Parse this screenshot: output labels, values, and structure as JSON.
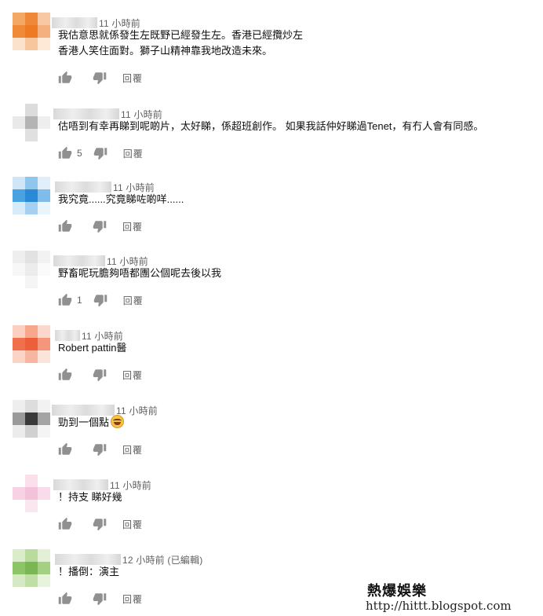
{
  "comments": [
    {
      "time": "11 小時前",
      "lines": [
        "我估意思就係發生左既野已經發生左。香港已經攬炒左",
        "香港人笑住面對。獅子山精神靠我地改造未來。"
      ],
      "likes": "",
      "reply_label": "回覆",
      "avatar_colors": [
        "#f4a866",
        "#f0883a",
        "#f8c8a4",
        "#f08a38",
        "#ee7a24",
        "#f4b07e",
        "#fbe2cc",
        "#f7c69c",
        "#fde9d6"
      ]
    },
    {
      "time": "11 小時前",
      "lines": [
        "估唔到有幸再睇到呢啲片，太好睇，係超班創作。 如果我話仲好睇過Tenet，有冇人會有同感。"
      ],
      "likes": "5",
      "reply_label": "回覆",
      "avatar_colors": [
        "#ffffff",
        "#dcdcdc",
        "#ffffff",
        "#e9e9e9",
        "#b4b4b4",
        "#eeeeee",
        "#ffffff",
        "#e0e0e0",
        "#ffffff"
      ]
    },
    {
      "time": "11 小時前",
      "lines": [
        "我究竟......究竟睇咗啲咩......"
      ],
      "likes": "",
      "reply_label": "回覆",
      "avatar_colors": [
        "#cfe6f8",
        "#8ec6ee",
        "#e1effa",
        "#4aa2e0",
        "#2a8ad6",
        "#7fbcea",
        "#d8ebf8",
        "#a6d0f2",
        "#eaf4fc"
      ]
    },
    {
      "time": "11 小時前",
      "lines": [
        "野畜呢玩膽夠唔都團公個呢去後以我"
      ],
      "likes": "1",
      "reply_label": "回覆",
      "avatar_colors": [
        "#eeeeee",
        "#e2e2e2",
        "#f2f2f2",
        "#f7f7f7",
        "#ececec",
        "#fafafa",
        "#ffffff",
        "#f5f5f5",
        "#ffffff"
      ]
    },
    {
      "time": "11 小時前",
      "lines": [
        "Robert pattin醫"
      ],
      "likes": "",
      "reply_label": "回覆",
      "avatar_colors": [
        "#fbd0c0",
        "#f6a78c",
        "#fcd8cc",
        "#f0704e",
        "#ec5f3a",
        "#f3967a",
        "#fbd4c6",
        "#f7b6a0",
        "#fde4da"
      ]
    },
    {
      "time": "11 小時前",
      "lines": [
        "勁到一個點"
      ],
      "likes": "",
      "reply_label": "回覆",
      "avatar_colors": [
        "#eeeeee",
        "#dddddd",
        "#f2f2f2",
        "#9a9a9a",
        "#3a3a3a",
        "#a4a4a4",
        "#ececec",
        "#d0d0d0",
        "#f4f4f4"
      ]
    },
    {
      "time": "11 小時前",
      "lines": [
        "！持支 睇好幾"
      ],
      "likes": "",
      "reply_label": "回覆",
      "avatar_colors": [
        "#ffffff",
        "#fbe0ec",
        "#ffffff",
        "#f6d2e4",
        "#f2c2da",
        "#f9dcea",
        "#ffffff",
        "#fae6ef",
        "#ffffff"
      ]
    },
    {
      "time": "12 小時前 (已編輯)",
      "lines": [
        "！播倒：演主"
      ],
      "likes": "",
      "reply_label": "回覆",
      "avatar_colors": [
        "#dbecca",
        "#b9dc9c",
        "#e3f0d6",
        "#8cc468",
        "#7ab654",
        "#a4d084",
        "#d6e9c4",
        "#c0df a6",
        "#e8f3dd"
      ]
    }
  ],
  "icons": {
    "like": "thumbs-up-icon",
    "dislike": "thumbs-down-icon"
  },
  "watermark": {
    "title": "熱爆娛樂",
    "url": "http://hittt.blogspot.com"
  }
}
